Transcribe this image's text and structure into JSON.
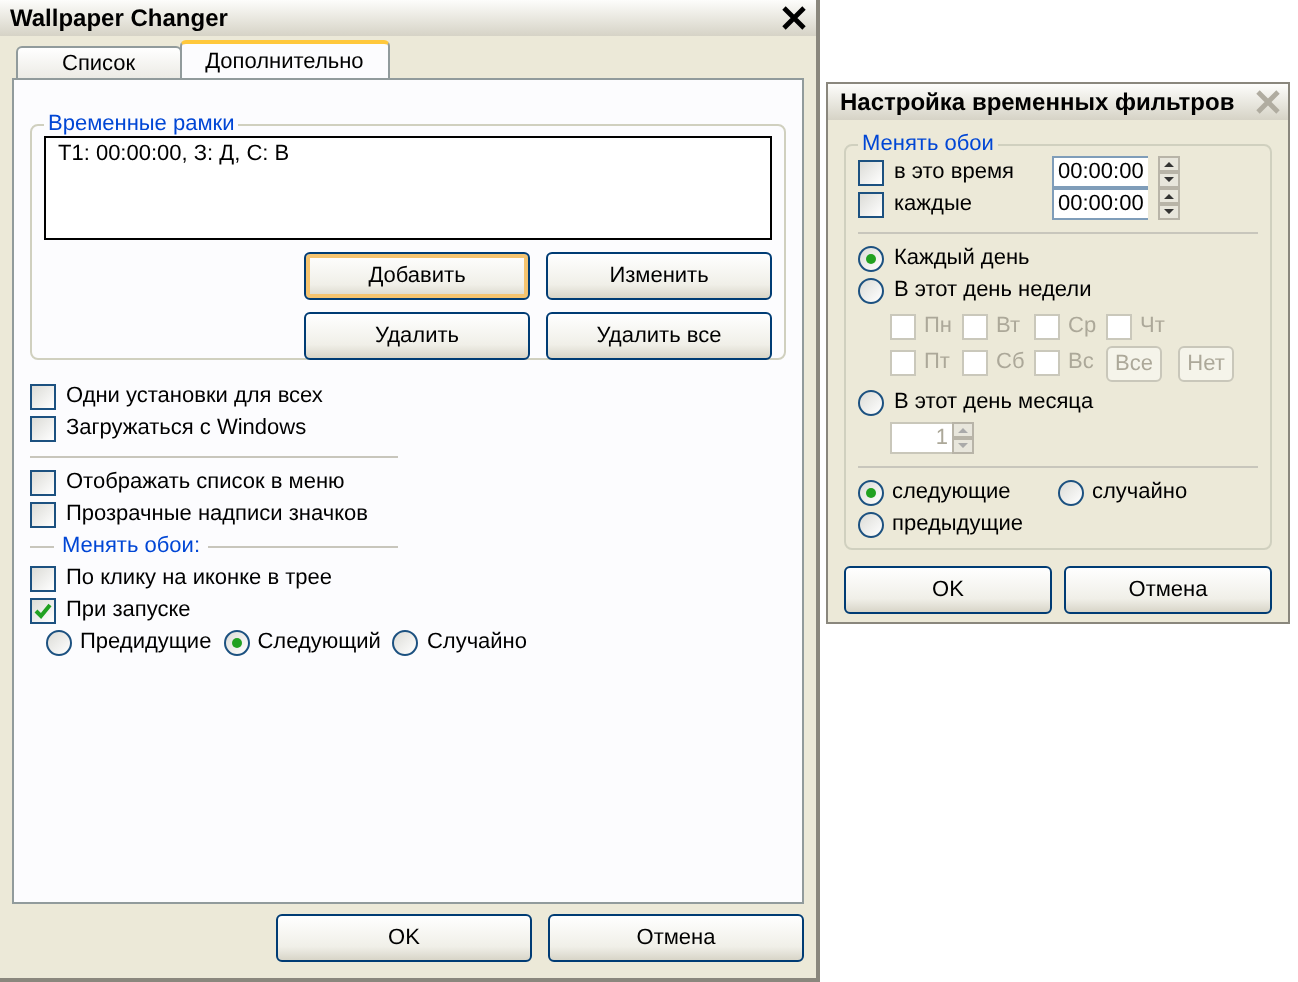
{
  "window": {
    "title": "Wallpaper Changer"
  },
  "tabs": [
    {
      "label": "Список",
      "selected": false
    },
    {
      "label": "Дополнительно",
      "selected": true
    }
  ],
  "time_frames": {
    "title": "Временные рамки",
    "entries": [
      "T1: 00:00:00, З: Д, С: В"
    ],
    "buttons": [
      {
        "label": "Добавить",
        "focused": true
      },
      {
        "label": "Изменить",
        "focused": false
      },
      {
        "label": "Удалить",
        "focused": false
      },
      {
        "label": "Удалить все",
        "focused": false
      }
    ]
  },
  "options": [
    {
      "kind": "checkbox",
      "label": "Одни установки для всех",
      "checked": false
    },
    {
      "kind": "checkbox",
      "label": "Загружаться с Windows",
      "checked": false
    },
    {
      "kind": "separator"
    },
    {
      "kind": "checkbox",
      "label": "Отображать список в меню",
      "checked": false
    },
    {
      "kind": "checkbox",
      "label": "Прозрачные надписи значков",
      "checked": false
    },
    {
      "kind": "heading",
      "label": "Менять обои:"
    },
    {
      "kind": "checkbox",
      "label": "По клику на иконке в трее",
      "checked": false
    },
    {
      "kind": "checkbox",
      "label": "При запуске",
      "checked": true
    },
    {
      "kind": "radios",
      "options": [
        {
          "label": "Предидущие",
          "selected": false
        },
        {
          "label": "Следующий",
          "selected": true
        },
        {
          "label": "Случайно",
          "selected": false
        }
      ]
    }
  ],
  "footer_buttons": [
    "OK",
    "Отмена"
  ],
  "dialog": {
    "title": "Настройка временных фильтров",
    "group_title": "Менять обои",
    "time_rows": [
      {
        "label": "в это время",
        "checked": false,
        "value": "00:00:00"
      },
      {
        "label": "каждые",
        "checked": false,
        "value": "00:00:00"
      }
    ],
    "schedule": [
      {
        "label": "Каждый день",
        "selected": true
      },
      {
        "label": "В этот день недели",
        "selected": false,
        "disabled": true,
        "days": [
          {
            "label": "Пн",
            "checked": false
          },
          {
            "label": "Вт",
            "checked": false
          },
          {
            "label": "Ср",
            "checked": false
          },
          {
            "label": "Чт",
            "checked": false
          },
          {
            "label": "Пт",
            "checked": false
          },
          {
            "label": "Сб",
            "checked": false
          },
          {
            "label": "Вс",
            "checked": false
          }
        ],
        "day_buttons": [
          "Все",
          "Нет"
        ]
      },
      {
        "label": "В этот день месяца",
        "selected": false,
        "disabled": true,
        "day_of_month": "1"
      }
    ],
    "order": [
      {
        "label": "следующие",
        "selected": true
      },
      {
        "label": "случайно",
        "selected": false
      },
      {
        "label": "предыдущие",
        "selected": false
      }
    ],
    "buttons": [
      "OK",
      "Отмена"
    ]
  }
}
